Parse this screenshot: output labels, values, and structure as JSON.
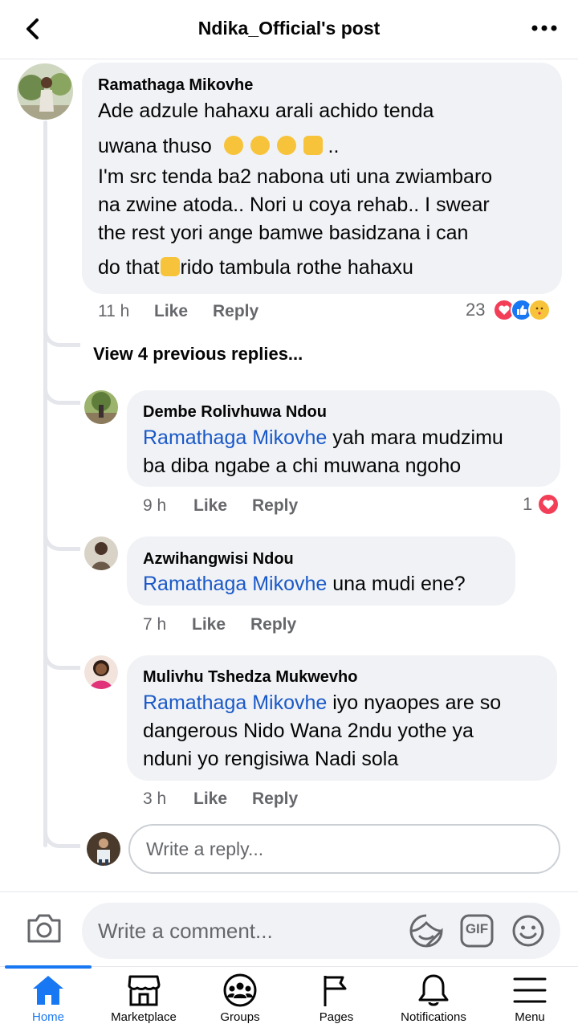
{
  "header": {
    "title": "Ndika_Official's post"
  },
  "main_comment": {
    "author": "Ramathaga Mikovhe",
    "lines": [
      "Ade adzule hahaxu arali achido tenda",
      "uwana thuso",
      "I'm src tenda ba2 nabona uti una zwiambaro",
      "na zwine atoda.. Nori u coya rehab.. I swear",
      "the rest yori ange bamwe basidzana i can",
      "do that",
      "rido tambula rothe hahaxu"
    ],
    "line2_suffix": "..",
    "time": "11 h",
    "like": "Like",
    "reply": "Reply",
    "reaction_count": "23"
  },
  "view_previous": "View 4 previous replies...",
  "replies": [
    {
      "author": "Dembe Rolivhuwa Ndou",
      "mention": "Ramathaga Mikovhe",
      "lines": [
        " yah mara mudzimu",
        "ba diba ngabe a chi muwana ngoho"
      ],
      "time": "9 h",
      "like": "Like",
      "reply": "Reply",
      "reaction_count": "1"
    },
    {
      "author": "Azwihangwisi Ndou",
      "mention": "Ramathaga Mikovhe",
      "lines": [
        " una mudi ene?"
      ],
      "time": "7 h",
      "like": "Like",
      "reply": "Reply"
    },
    {
      "author": "Mulivhu Tshedza Mukwevho",
      "mention": "Ramathaga Mikovhe",
      "lines": [
        " iyo nyaopes are so",
        "dangerous Nido Wana 2ndu yothe ya",
        "nduni yo rengisiwa Nadi sola"
      ],
      "time": "3 h",
      "like": "Like",
      "reply": "Reply"
    }
  ],
  "reply_input": {
    "placeholder": "Write a reply..."
  },
  "comment_input": {
    "placeholder": "Write a comment..."
  },
  "comment_tools": {
    "gif": "GIF"
  },
  "nav": [
    {
      "label": "Home",
      "icon": "home-icon",
      "active": true
    },
    {
      "label": "Marketplace",
      "icon": "marketplace-icon"
    },
    {
      "label": "Groups",
      "icon": "groups-icon"
    },
    {
      "label": "Pages",
      "icon": "flag-icon"
    },
    {
      "label": "Notifications",
      "icon": "bell-icon"
    },
    {
      "label": "Menu",
      "icon": "menu-icon"
    }
  ],
  "colors": {
    "accent": "#1877f2",
    "mention": "#1a59c8",
    "bubble": "#f0f2f5",
    "secondary_text": "#65676b"
  }
}
